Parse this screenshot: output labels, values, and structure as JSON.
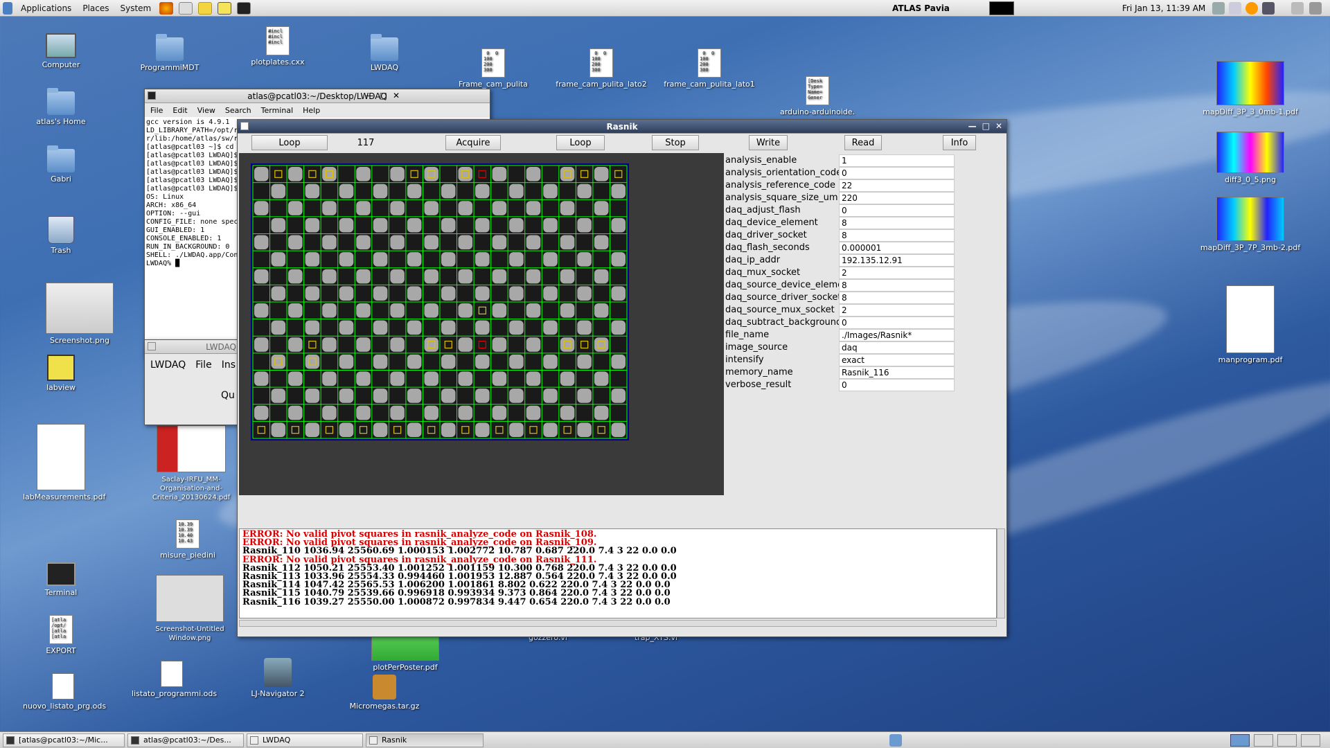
{
  "top_panel": {
    "menus": [
      "Applications",
      "Places",
      "System"
    ],
    "hostname": "ATLAS Pavia",
    "clock": "Fri Jan 13, 11:39 AM"
  },
  "desktop_icons_left": [
    {
      "label": "Computer",
      "kind": "computer"
    },
    {
      "label": "atlas's Home",
      "kind": "home"
    },
    {
      "label": "Gabri",
      "kind": "folder"
    },
    {
      "label": "Trash",
      "kind": "trash"
    },
    {
      "label": "Screenshot.png",
      "kind": "image"
    },
    {
      "label": "labview",
      "kind": "labview"
    },
    {
      "label": "labMeasurements.pdf",
      "kind": "pdf"
    }
  ],
  "desktop_icons_mid": [
    {
      "label": "ProgrammiMDT",
      "kind": "folder"
    },
    {
      "label": "plotplates.cxx",
      "kind": "doc",
      "text": "#incl\n#incl\n#incl"
    },
    {
      "label": "LWDAQ",
      "kind": "folder"
    },
    {
      "label": "Frame_cam_pulita",
      "kind": "doc",
      "text": " 0  0\n100\n200\n300"
    },
    {
      "label": "frame_cam_pulita_lato2",
      "kind": "doc",
      "text": " 0  0\n100\n200\n300"
    },
    {
      "label": "frame_cam_pulita_lato1",
      "kind": "doc",
      "text": " 0  0\n100\n200\n300"
    },
    {
      "label": "arduino-arduinoide.",
      "kind": "doc",
      "text": "[Desk\nType=\nName=\nGener"
    },
    {
      "label": "Saclay-IRFU_MM-Organisation-and-Criteria_20130624.pdf",
      "kind": "pdf"
    },
    {
      "label": "misure_piedini",
      "kind": "doc",
      "text": "10.39\n10.39\n10.40\n10.43"
    },
    {
      "label": "Terminal",
      "kind": "terminal"
    },
    {
      "label": "Screenshot-Untitled Window.png",
      "kind": "image"
    },
    {
      "label": "EXPORT",
      "kind": "doc",
      "text": "[atla\n/opt/\n[atla\n[atla"
    },
    {
      "label": "nuovo_listato_prg.ods",
      "kind": "sheet"
    },
    {
      "label": "listato_programmi.ods",
      "kind": "sheet"
    },
    {
      "label": "LJ-Navigator 2",
      "kind": "app"
    },
    {
      "label": "Micromegas.tar.gz",
      "kind": "archive"
    },
    {
      "label": "plotPerPoster.pdf",
      "kind": "pdf"
    },
    {
      "label": "gozzero.vi",
      "kind": "file"
    },
    {
      "label": "trap_XTS.vi",
      "kind": "file"
    }
  ],
  "desktop_icons_right": [
    {
      "label": "mapDiff_3P_3_0mb-1.pdf"
    },
    {
      "label": "diff3_0_5.png"
    },
    {
      "label": "mapDiff_3P_7P_3mb-2.pdf"
    },
    {
      "label": "manprogram.pdf"
    }
  ],
  "terminal": {
    "title": "atlas@pcatl03:~/Desktop/LWDAQ",
    "menus": [
      "File",
      "Edit",
      "View",
      "Search",
      "Terminal",
      "Help"
    ],
    "lines": [
      "gcc version is 4.9.1",
      "LD_LIBRARY_PATH=/opt/r",
      "r/lib:/home/atlas/sw/r",
      "[atlas@pcatl03 ~]$ cd",
      "[atlas@pcatl03 LWDAQ]$",
      "[atlas@pcatl03 LWDAQ]$",
      "[atlas@pcatl03 LWDAQ]$",
      "[atlas@pcatl03 LWDAQ]$",
      "[atlas@pcatl03 LWDAQ]$",
      "OS: Linux",
      "ARCH: x86_64",
      "OPTION: --gui",
      "CONFIG_FILE: none spec",
      "GUI_ENABLED: 1",
      "CONSOLE_ENABLED: 1",
      "RUN_IN_BACKGROUND: 0",
      "SHELL: ./LWDAQ.app/Con",
      "LWDAQ% █"
    ]
  },
  "lwdaq_window": {
    "title": "LWDAQ",
    "menus": [
      "LWDAQ",
      "File",
      "Ins"
    ],
    "button": "Qu"
  },
  "rasnik": {
    "title": "Rasnik",
    "buttons": {
      "loop1": "Loop",
      "counter": "117",
      "acquire": "Acquire",
      "loop2": "Loop",
      "stop": "Stop",
      "write": "Write",
      "read": "Read",
      "info": "Info"
    },
    "params": [
      {
        "name": "analysis_enable",
        "value": "1"
      },
      {
        "name": "analysis_orientation_code",
        "value": "0"
      },
      {
        "name": "analysis_reference_code",
        "value": "22"
      },
      {
        "name": "analysis_square_size_um",
        "value": "220"
      },
      {
        "name": "daq_adjust_flash",
        "value": "0"
      },
      {
        "name": "daq_device_element",
        "value": "8"
      },
      {
        "name": "daq_driver_socket",
        "value": "8"
      },
      {
        "name": "daq_flash_seconds",
        "value": "0.000001"
      },
      {
        "name": "daq_ip_addr",
        "value": "192.135.12.91"
      },
      {
        "name": "daq_mux_socket",
        "value": "2"
      },
      {
        "name": "daq_source_device_element",
        "value": "8"
      },
      {
        "name": "daq_source_driver_socket",
        "value": "8"
      },
      {
        "name": "daq_source_mux_socket",
        "value": "2"
      },
      {
        "name": "daq_subtract_background",
        "value": "0"
      },
      {
        "name": "file_name",
        "value": "./Images/Rasnik*"
      },
      {
        "name": "image_source",
        "value": "daq"
      },
      {
        "name": "intensify",
        "value": "exact"
      },
      {
        "name": "memory_name",
        "value": "Rasnik_116"
      },
      {
        "name": "verbose_result",
        "value": "0"
      }
    ],
    "console": [
      {
        "text": "ERROR: No valid pivot squares in rasnik_analyze_code on Rasnik_108.",
        "error": true
      },
      {
        "text": "ERROR: No valid pivot squares in rasnik_analyze_code on Rasnik_109.",
        "error": true
      },
      {
        "text": "Rasnik_110 1036.94 25560.69 1.000153 1.002772 10.787 0.687 220.0 7.4 3 22 0.0 0.0",
        "error": false
      },
      {
        "text": "ERROR: No valid pivot squares in rasnik_analyze_code on Rasnik_111.",
        "error": true
      },
      {
        "text": "Rasnik_112 1050.21 25553.40 1.001252 1.001159 10.300 0.768 220.0 7.4 3 22 0.0 0.0",
        "error": false
      },
      {
        "text": "Rasnik_113 1033.96 25554.33 0.994460 1.001953 12.887 0.564 220.0 7.4 3 22 0.0 0.0",
        "error": false
      },
      {
        "text": "Rasnik_114 1047.42 25565.53 1.006200 1.001861 8.802 0.622 220.0 7.4 3 22 0.0 0.0",
        "error": false
      },
      {
        "text": "Rasnik_115 1040.79 25539.66 0.996918 0.993934 9.373 0.864 220.0 7.4 3 22 0.0 0.0",
        "error": false
      },
      {
        "text": "Rasnik_116 1039.27 25550.00 1.000872 0.997834 9.447 0.654 220.0 7.4 3 22 0.0 0.0",
        "error": false
      }
    ]
  },
  "taskbar": {
    "tasks": [
      "[atlas@pcatl03:~/Mic...",
      "atlas@pcatl03:~/Des...",
      "LWDAQ",
      "Rasnik"
    ],
    "active": 3
  },
  "colors": {
    "desktop": "#3e6fb3",
    "error": "#dd0000",
    "grid": "#00ff00",
    "marker_yellow": "#e0c000",
    "marker_red": "#e00000"
  }
}
